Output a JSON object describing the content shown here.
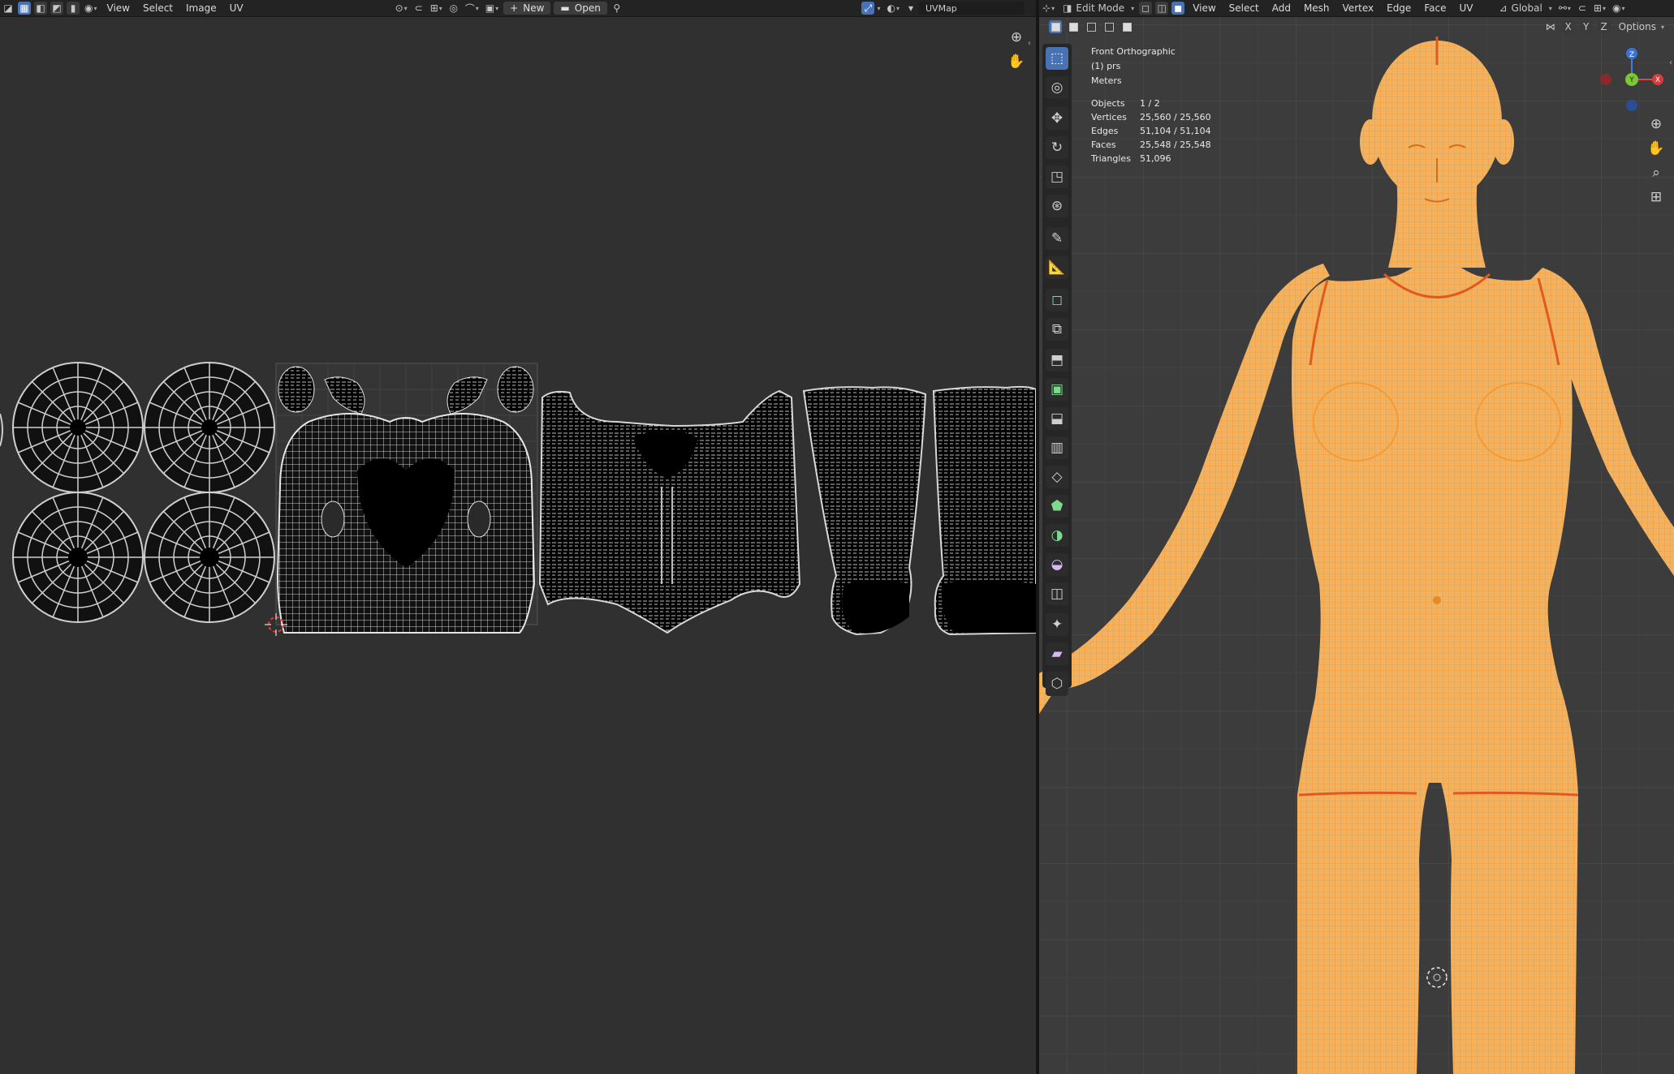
{
  "uv_editor": {
    "header": {
      "menus": [
        "View",
        "Select",
        "Image",
        "UV"
      ],
      "new_label": "New",
      "open_label": "Open",
      "uvmap_value": "UVMap"
    }
  },
  "viewport": {
    "header": {
      "mode_label": "Edit Mode",
      "menus": [
        "View",
        "Select",
        "Add",
        "Mesh",
        "Vertex",
        "Edge",
        "Face",
        "UV"
      ],
      "orientation_label": "Global",
      "options_label": "Options",
      "axis_buttons": [
        "X",
        "Y",
        "Z"
      ]
    },
    "overlay": {
      "view_name": "Front Orthographic",
      "object_name": "(1) prs",
      "units": "Meters",
      "stats": [
        {
          "label": "Objects",
          "value": "1 / 2"
        },
        {
          "label": "Vertices",
          "value": "25,560 / 25,560"
        },
        {
          "label": "Edges",
          "value": "51,104 / 51,104"
        },
        {
          "label": "Faces",
          "value": "25,548 / 25,548"
        },
        {
          "label": "Triangles",
          "value": "51,096"
        }
      ]
    },
    "gizmo": {
      "z": "Z",
      "y": "Y",
      "x": "X"
    },
    "colors": {
      "mesh": "#f0a030",
      "seam": "#e05a1e",
      "accent": "#4772b3"
    }
  }
}
